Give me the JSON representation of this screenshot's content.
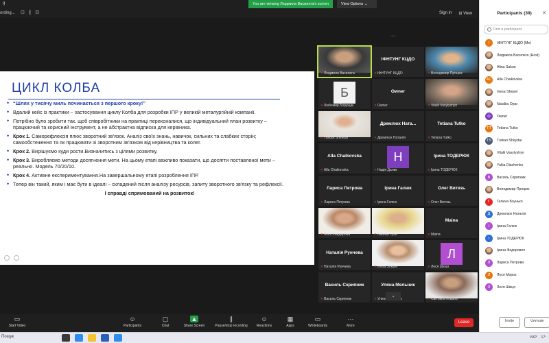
{
  "topbar": {
    "recording_left": "g",
    "recording_label": "ording...",
    "window_controls": "⊡ ∥ ⊟",
    "viewing_banner": "You are viewing Людмила Василега's screen",
    "view_options": "View Options",
    "view_options_chevron": "⌄",
    "sign_in": "Sign in",
    "view": "⊟ View"
  },
  "slide": {
    "title": "ЦИКЛ КОЛБА",
    "bullets": [
      {
        "bold": "",
        "text": "“Шлях у тисячу миль починається з першого кроку!”",
        "quote": true
      },
      {
        "bold": "",
        "text": "Вдалий кейс із практики – застосування циклу Колба для розробки  ІПР у великій металургійній компанії."
      },
      {
        "bold": "",
        "text": "Потрібно було зробити так, щоб співробітники на практиці переконалися, що індивідуальний план розвитку – працюючий та корисний інструмент, а не абстрактна відписка для керівника."
      },
      {
        "bold": "Крок 1.",
        "text": " Саморефлексія плюс зворотний зв'язок. Аналіз своїх знань, навичок, сильних та слабких сторін; самообстеження та як працювати зі зворотним зв'язком від керівництва та колег."
      },
      {
        "bold": "Крок 2.",
        "text": " Вирішуємо куди рости.Визначитись з цілями розвитку."
      },
      {
        "bold": "Крок 3.",
        "text": " Виробляємо методи досягнення мети. На цьому етапі важливо  показати, що досягти поставленої мети – реально. Модель 70/20/10."
      },
      {
        "bold": "Крок 4.",
        "text": " Активне експериментування.На завершальному етапі розроблення ІПР."
      },
      {
        "bold": "",
        "text": "Тепер він такий, яким і має бути в ідеалі – складений після аналізу ресурсів, запиту зворотного зв'язку та рефлексії."
      }
    ],
    "final": "І справді спрямований на розвиток!"
  },
  "tiles": [
    {
      "name": "",
      "label": "Людмила Василега",
      "photo": "p1",
      "active": true
    },
    {
      "name": "ІФНТУНГ КЦДО",
      "label": "ІФНТУНГ КЦДО"
    },
    {
      "name": "",
      "label": "Володимир Процюк",
      "photo": "p2"
    },
    {
      "name": "",
      "label": "Любомир Борущак",
      "avatar": "Б",
      "avatar_color": "#f2f2f2",
      "avatar_text": "#555"
    },
    {
      "name": "Owner",
      "label": "Owner"
    },
    {
      "name": "",
      "label": "Vitalii Vasylyshyn",
      "photo": "p3"
    },
    {
      "name": "",
      "label": "Turkan Sheydai",
      "photo": "p4"
    },
    {
      "name": "Дремлюх  Ната...",
      "label": "Дремлюх Наталія"
    },
    {
      "name": "Tetiana Tutko",
      "label": "Tetiana Tutko"
    },
    {
      "name": "Alla Chaikovska",
      "label": "Alla Chaikovska"
    },
    {
      "name": "",
      "label": "Надія Далик",
      "avatar": "Н",
      "avatar_color": "#7e3fbf",
      "avatar_text": "#fff"
    },
    {
      "name": "Ірина ТОДЕРЮК",
      "label": "Ірина ТОДЕРЮК"
    },
    {
      "name": "Лариса Петрова",
      "label": "Лариса Петрова"
    },
    {
      "name": "Ірина Галюк",
      "label": "Ірина Галюк"
    },
    {
      "name": "Олег Витязь",
      "label": "Олег Витязь"
    },
    {
      "name": "",
      "label": "Лілія Хайдарова",
      "photo": "p5"
    },
    {
      "name": "",
      "label": "Nataliia Opar",
      "photo": "p6"
    },
    {
      "name": "Maina",
      "label": "Maina"
    },
    {
      "name": "Наталія Рунчева",
      "label": "Наталія Рунчева"
    },
    {
      "name": "",
      "label": "Inesa Shepel",
      "photo": "p8"
    },
    {
      "name": "",
      "label": "Леся Шкіця",
      "avatar": "Л",
      "avatar_color": "#b24fd0",
      "avatar_text": "#fff"
    },
    {
      "name": "Василь Скрипник",
      "label": "Василь Скрипник"
    },
    {
      "name": "Уляна Мельник",
      "label": "Уляна Мельник"
    },
    {
      "name": "",
      "label": "Світлана Коваль",
      "photo": "p10"
    }
  ],
  "participants": {
    "title": "Participants (39)",
    "close_icon": "✕",
    "search_placeholder": "Find a participant",
    "list": [
      {
        "name": "ІФНТУНГ КЦДО (Me)",
        "initial": "І",
        "color": "#e8760e"
      },
      {
        "name": "Людмила Василега (Host)",
        "initial": "",
        "color": "",
        "photo": true
      },
      {
        "name": "Alina Sakun",
        "initial": "",
        "color": "",
        "photo": true
      },
      {
        "name": "Alla Chaikovska",
        "initial": "AC",
        "color": "#e8760e"
      },
      {
        "name": "Inesa Shepel",
        "initial": "",
        "color": "",
        "photo": true
      },
      {
        "name": "Nataliia Opar",
        "initial": "",
        "color": "",
        "photo": true
      },
      {
        "name": "Owner",
        "initial": "O",
        "color": "#7e3fbf"
      },
      {
        "name": "Tetiana Tutko",
        "initial": "TT",
        "color": "#e8760e"
      },
      {
        "name": "Turkan Sheydai",
        "initial": "TS",
        "color": "#4a5b78"
      },
      {
        "name": "Vitalii Vasylyshyn",
        "initial": "",
        "color": "",
        "photo": true
      },
      {
        "name": "Yuliia Diachenko",
        "initial": "",
        "color": "",
        "photo": true
      },
      {
        "name": "Василь Скрипник",
        "initial": "В",
        "color": "#b24fd0"
      },
      {
        "name": "Володимир Процюк",
        "initial": "",
        "color": "",
        "photo": true
      },
      {
        "name": "Галина Бзунько",
        "initial": "Г",
        "color": "#e02828"
      },
      {
        "name": "Дремлюх Наталія",
        "initial": "Д",
        "color": "#2d6fd6"
      },
      {
        "name": "Ірина Галюк",
        "initial": "І",
        "color": "#b24fd0"
      },
      {
        "name": "Ірина ТОДЕРЮК",
        "initial": "І",
        "color": "#2d6fd6"
      },
      {
        "name": "Ірина Федорович",
        "initial": "",
        "color": "",
        "photo": true
      },
      {
        "name": "Лариса Петрова",
        "initial": "Л",
        "color": "#b24fd0"
      },
      {
        "name": "Леся Мороз",
        "initial": "Л",
        "color": "#e8760e"
      },
      {
        "name": "Леся Шкіця",
        "initial": "Л",
        "color": "#b24fd0"
      }
    ],
    "invite": "Invite",
    "unmute": "Unmute"
  },
  "toolbar": {
    "start_video": "Start Video",
    "participants": "Participants",
    "participants_count": "39",
    "chat": "Chat",
    "share_screen": "Share Screen",
    "record": "Pause/stop recording",
    "reactions": "Reactions",
    "apps": "Apps",
    "whiteboards": "Whiteboards",
    "more": "More",
    "leave": "Leave"
  },
  "taskbar": {
    "search": "Пошук",
    "lang": "УКР",
    "time": "17:"
  }
}
